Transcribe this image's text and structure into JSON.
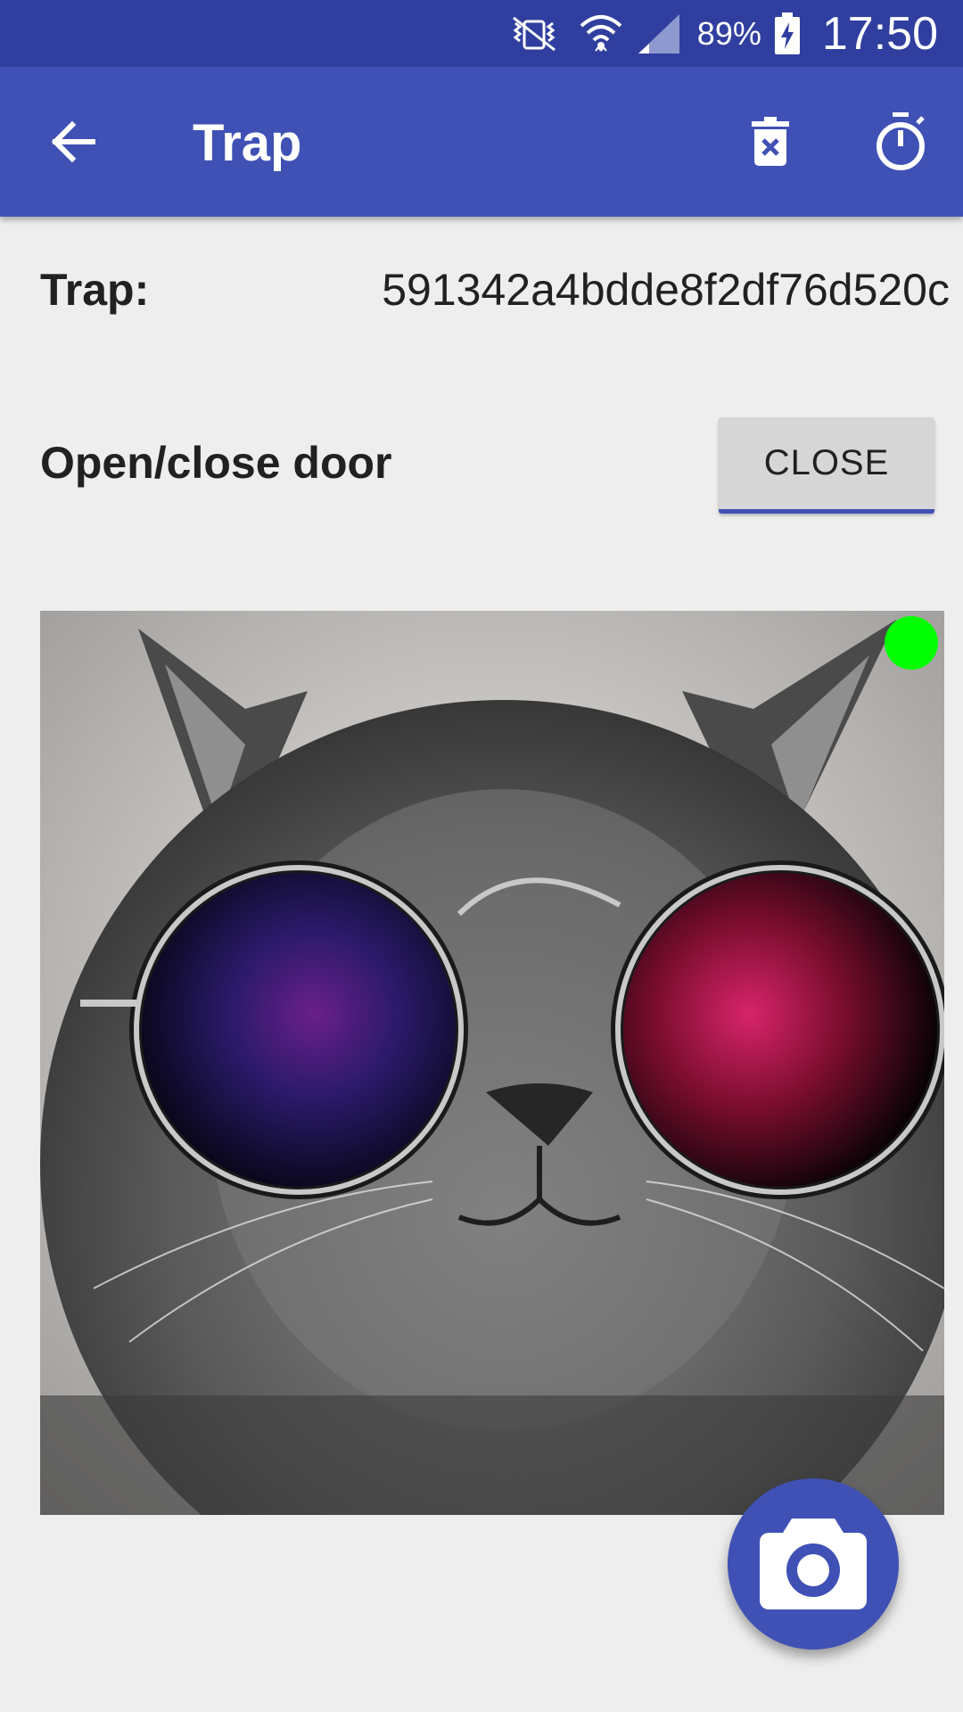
{
  "status_bar": {
    "battery_percent": "89%",
    "time": "17:50",
    "icons": [
      "vibrate-icon",
      "wifi-icon",
      "signal-icon",
      "battery-charging-icon"
    ]
  },
  "app_bar": {
    "title": "Trap",
    "icons": [
      "arrow-back-icon",
      "delete-icon",
      "timer-icon"
    ]
  },
  "trap": {
    "label": "Trap:",
    "id": "591342a4bdde8f2df76d520c"
  },
  "door": {
    "label": "Open/close door",
    "button_label": "CLOSE"
  },
  "photo": {
    "status_color": "#00ff00"
  },
  "fab": {
    "icon": "camera-icon"
  },
  "colors": {
    "primary": "#3f51b5",
    "primary_dark": "#303f9f",
    "background": "#eeeeee"
  }
}
